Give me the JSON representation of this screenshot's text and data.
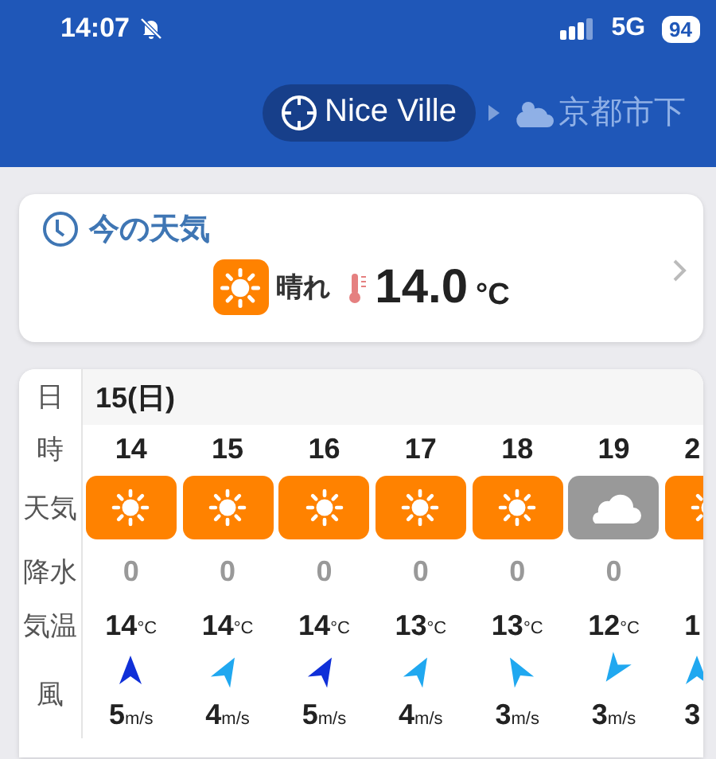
{
  "status_bar": {
    "time": "14:07",
    "network": "5G",
    "battery": "94"
  },
  "location_nav": {
    "current": "Nice Ville",
    "next": "京都市下"
  },
  "current_weather": {
    "title": "今の天気",
    "condition": "晴れ",
    "kind": "sunny",
    "temperature": "14.0",
    "unit": "°C"
  },
  "forecast": {
    "row_labels": [
      "日",
      "時",
      "天気",
      "降水",
      "気温",
      "風"
    ],
    "date": "15(日)",
    "columns": [
      {
        "hour": "14",
        "kind": "sunny",
        "precip": "0",
        "temp": "14",
        "temp_unit": "°C",
        "wind": {
          "kind": "up",
          "color": "#1030d8",
          "speed": "5",
          "unit": "m/s"
        }
      },
      {
        "hour": "15",
        "kind": "sunny",
        "precip": "0",
        "temp": "14",
        "temp_unit": "°C",
        "wind": {
          "kind": "up-right",
          "color": "#20a8f0",
          "speed": "4",
          "unit": "m/s"
        }
      },
      {
        "hour": "16",
        "kind": "sunny",
        "precip": "0",
        "temp": "14",
        "temp_unit": "°C",
        "wind": {
          "kind": "up-right",
          "color": "#1030d8",
          "speed": "5",
          "unit": "m/s"
        }
      },
      {
        "hour": "17",
        "kind": "sunny",
        "precip": "0",
        "temp": "13",
        "temp_unit": "°C",
        "wind": {
          "kind": "up-right",
          "color": "#20a8f0",
          "speed": "4",
          "unit": "m/s"
        }
      },
      {
        "hour": "18",
        "kind": "sunny",
        "precip": "0",
        "temp": "13",
        "temp_unit": "°C",
        "wind": {
          "kind": "up-left",
          "color": "#20a8f0",
          "speed": "3",
          "unit": "m/s"
        }
      },
      {
        "hour": "19",
        "kind": "cloudy",
        "precip": "0",
        "temp": "12",
        "temp_unit": "°C",
        "wind": {
          "kind": "down-left",
          "color": "#20a8f0",
          "speed": "3",
          "unit": "m/s"
        }
      },
      {
        "hour": "2",
        "kind": "sunny",
        "temp": "1",
        "wind": {
          "kind": "up",
          "color": "#20a8f0",
          "speed": "3"
        }
      }
    ]
  }
}
